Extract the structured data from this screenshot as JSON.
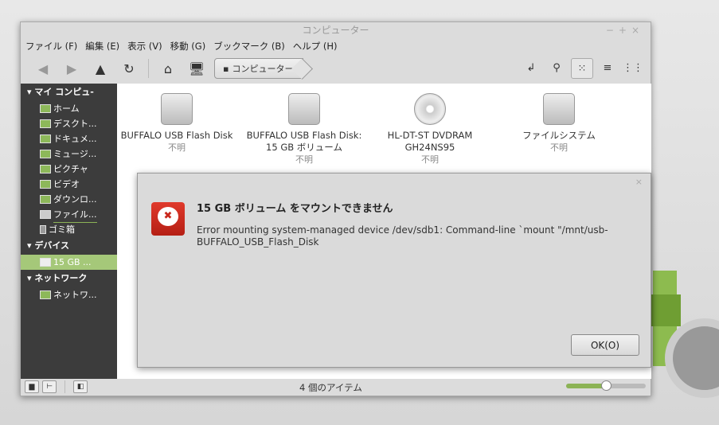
{
  "window": {
    "title": "コンピューター",
    "controls": [
      "−",
      "+",
      "×"
    ]
  },
  "menu": [
    "ファイル (F)",
    "編集 (E)",
    "表示 (V)",
    "移動 (G)",
    "ブックマーク (B)",
    "ヘルプ (H)"
  ],
  "breadcrumb": "コンピューター",
  "sidebar": {
    "sections": [
      {
        "title": "マイ コンピュ-",
        "items": [
          "ホーム",
          "デスクト...",
          "ドキュメ...",
          "ミュージ...",
          "ピクチャ",
          "ビデオ",
          "ダウンロ...",
          "ファイル...",
          "ゴミ箱"
        ]
      },
      {
        "title": "デバイス",
        "items": [
          "15 GB ..."
        ]
      },
      {
        "title": "ネットワーク",
        "items": [
          "ネットワ..."
        ]
      }
    ]
  },
  "items": [
    {
      "name": "BUFFALO USB Flash Disk",
      "sub": "不明",
      "icon": "usb-drive-icon"
    },
    {
      "name": "BUFFALO USB Flash Disk: 15 GB ボリューム",
      "sub": "不明",
      "icon": "usb-drive-icon"
    },
    {
      "name": "HL-DT-ST DVDRAM GH24NS95",
      "sub": "不明",
      "icon": "optical-disc-icon"
    },
    {
      "name": "ファイルシステム",
      "sub": "不明",
      "icon": "hard-disk-icon"
    }
  ],
  "status": {
    "text": "4 個のアイテム",
    "zoom_level": 0.5
  },
  "dialog": {
    "title": "15 GB ボリューム をマウントできません",
    "message": "Error mounting system-managed device /dev/sdb1: Command-line `mount \"/mnt/usb-BUFFALO_USB_Flash_Disk",
    "ok": "OK(O)"
  },
  "colors": {
    "accent": "#a5c879",
    "error": "#d0301f"
  }
}
